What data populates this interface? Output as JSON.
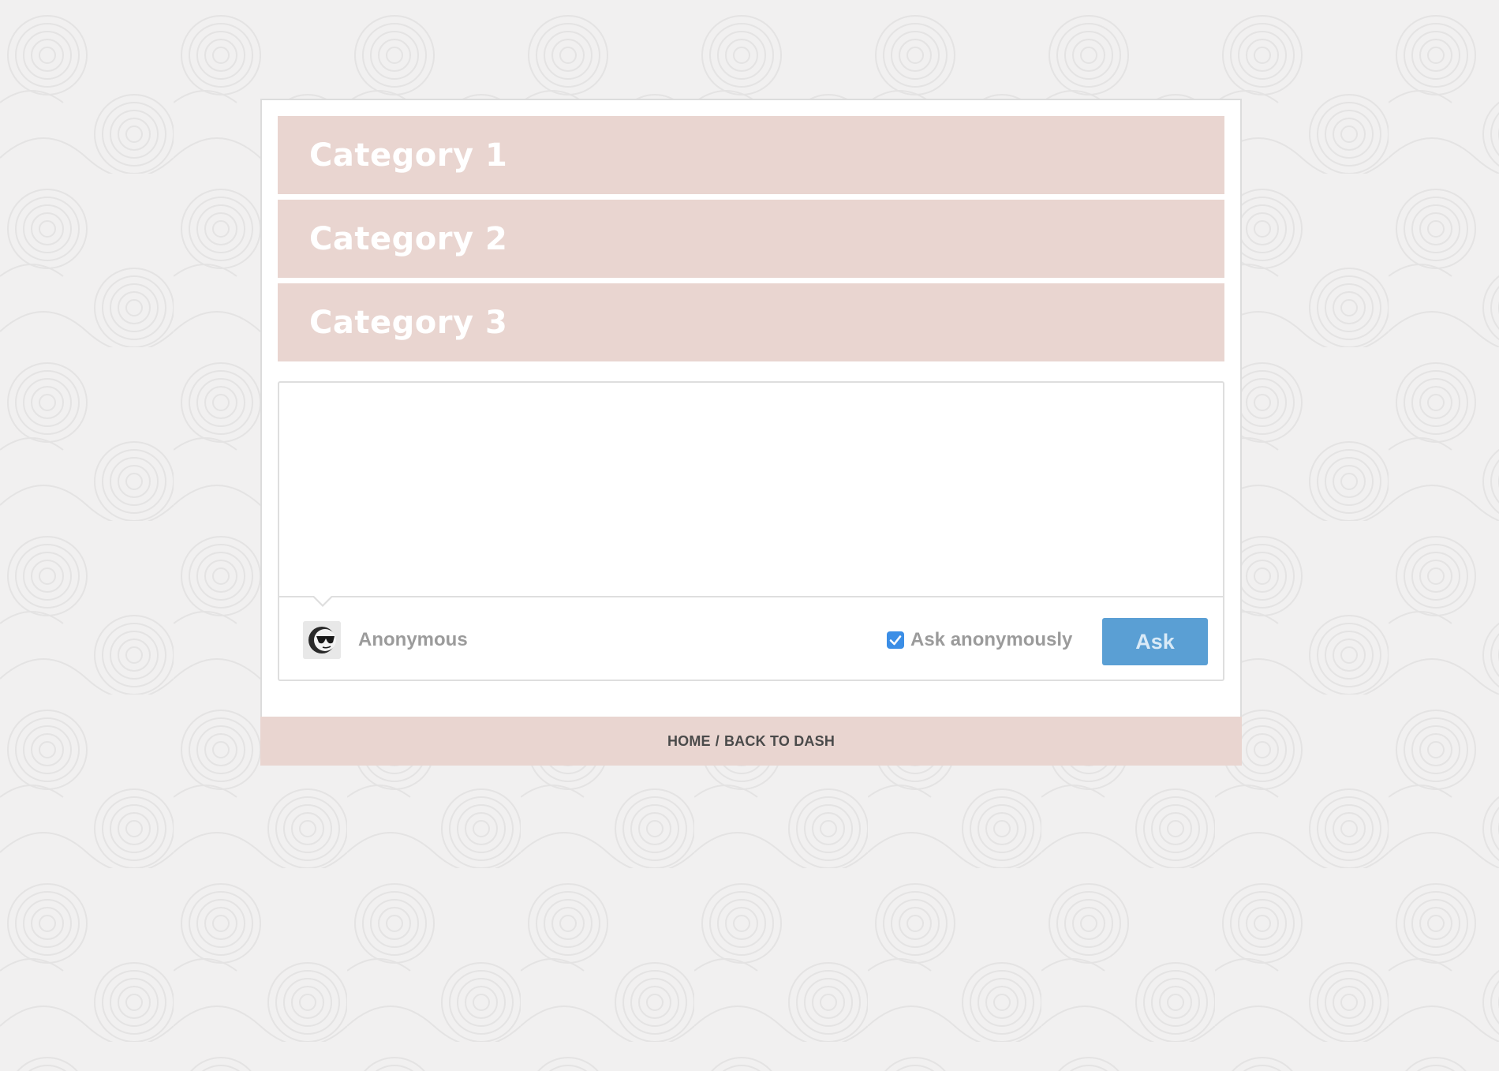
{
  "categories": [
    {
      "label": "Category 1"
    },
    {
      "label": "Category 2"
    },
    {
      "label": "Category 3"
    }
  ],
  "ask_form": {
    "question_value": "",
    "question_placeholder": "",
    "author_name": "Anonymous",
    "avatar_icon": "sunglasses-face-icon",
    "anonymous_checked": true,
    "anonymous_label": "Ask anonymously",
    "submit_label": "Ask"
  },
  "footer": {
    "home_label": "HOME",
    "separator": "/",
    "back_label": "BACK TO DASH"
  },
  "colors": {
    "category_bg": "#e9d5d0",
    "category_text": "#ffffff",
    "ask_button": "#5a9fd4",
    "checkbox": "#3b8ee6",
    "footer_bg": "#e9d5d0"
  }
}
